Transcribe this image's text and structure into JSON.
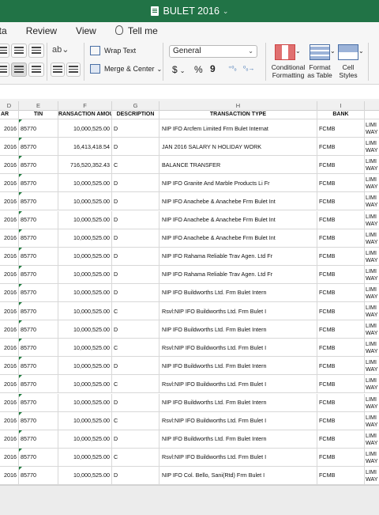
{
  "app": {
    "title": "BULET 2016",
    "accent": "#217346"
  },
  "menu": {
    "items": [
      "ata",
      "Review",
      "View"
    ],
    "tell_me": "Tell me"
  },
  "ribbon": {
    "wrap_text": "Wrap Text",
    "merge_center": "Merge & Center",
    "number_format": "General",
    "currency_symbol": "$",
    "percent_symbol": "%",
    "comma_symbol": "9",
    "increase_decimal": ".00→.0",
    "decrease_decimal": ".0→.00",
    "conditional_formatting": [
      "Conditional",
      "Formatting"
    ],
    "format_as_table": [
      "Format",
      "as Table"
    ],
    "cell_styles": [
      "Cell",
      "Styles"
    ]
  },
  "columns": [
    "D",
    "E",
    "F",
    "G",
    "H",
    "I"
  ],
  "headers": [
    "AR",
    "TIN",
    "RANSACTION AMOUN",
    "DESCRIPTION",
    "TRANSACTION TYPE",
    "BANK"
  ],
  "rows": [
    {
      "year": "2016",
      "tin": "85770",
      "amount": "10,000,525.00",
      "desc": "D",
      "type": "NIP IFO Arcfem Limited Frm Bulet Internat",
      "bank": "FCMB",
      "extra1": "LIMI",
      "extra2": "WAY"
    },
    {
      "year": "2016",
      "tin": "85770",
      "amount": "16,413,418.54",
      "desc": "D",
      "type": "JAN 2016 SALARY N HOLIDAY WORK",
      "bank": "FCMB",
      "extra1": "LIMI",
      "extra2": "WAY"
    },
    {
      "year": "2016",
      "tin": "85770",
      "amount": "716,520,352.43",
      "desc": "C",
      "type": "BALANCE TRANSFER",
      "bank": "FCMB",
      "extra1": "LIMI",
      "extra2": "WAY"
    },
    {
      "year": "2016",
      "tin": "85770",
      "amount": "10,000,525.00",
      "desc": "D",
      "type": "NIP IFO Granite And Marble Products Li Fr",
      "bank": "FCMB",
      "extra1": "LIMI",
      "extra2": "WAY"
    },
    {
      "year": "2016",
      "tin": "85770",
      "amount": "10,000,525.00",
      "desc": "D",
      "type": "NIP IFO Anachebe & Anachebe Frm Bulet Int",
      "bank": "FCMB",
      "extra1": "LIMI",
      "extra2": "WAY"
    },
    {
      "year": "2016",
      "tin": "85770",
      "amount": "10,000,525.00",
      "desc": "D",
      "type": "NIP IFO Anachebe & Anachebe Frm Bulet Int",
      "bank": "FCMB",
      "extra1": "LIMI",
      "extra2": "WAY"
    },
    {
      "year": "2016",
      "tin": "85770",
      "amount": "10,000,525.00",
      "desc": "D",
      "type": "NIP IFO Anachebe & Anachebe Frm Bulet Int",
      "bank": "FCMB",
      "extra1": "LIMI",
      "extra2": "WAY"
    },
    {
      "year": "2016",
      "tin": "85770",
      "amount": "10,000,525.00",
      "desc": "D",
      "type": "NIP IFO Rahama Reliable Trav Agen. Ltd Fr",
      "bank": "FCMB",
      "extra1": "LIMI",
      "extra2": "WAY"
    },
    {
      "year": "2016",
      "tin": "85770",
      "amount": "10,000,525.00",
      "desc": "D",
      "type": "NIP IFO Rahama Reliable Trav Agen. Ltd Fr",
      "bank": "FCMB",
      "extra1": "LIMI",
      "extra2": "WAY"
    },
    {
      "year": "2016",
      "tin": "85770",
      "amount": "10,000,525.00",
      "desc": "D",
      "type": "NIP IFO Buildworths Ltd. Frm Bulet Intern",
      "bank": "FCMB",
      "extra1": "LIMI",
      "extra2": "WAY"
    },
    {
      "year": "2016",
      "tin": "85770",
      "amount": "10,000,525.00",
      "desc": "C",
      "type": "Rsvl:NIP IFO Buildworths Ltd. Frm Bulet I",
      "bank": "FCMB",
      "extra1": "LIMI",
      "extra2": "WAY"
    },
    {
      "year": "2016",
      "tin": "85770",
      "amount": "10,000,525.00",
      "desc": "D",
      "type": "NIP IFO Buildworths Ltd. Frm Bulet Intern",
      "bank": "FCMB",
      "extra1": "LIMI",
      "extra2": "WAY"
    },
    {
      "year": "2016",
      "tin": "85770",
      "amount": "10,000,525.00",
      "desc": "C",
      "type": "Rsvl:NIP IFO Buildworths Ltd. Frm Bulet I",
      "bank": "FCMB",
      "extra1": "LIMI",
      "extra2": "WAY"
    },
    {
      "year": "2016",
      "tin": "85770",
      "amount": "10,000,525.00",
      "desc": "D",
      "type": "NIP IFO Buildworths Ltd. Frm Bulet Intern",
      "bank": "FCMB",
      "extra1": "LIMI",
      "extra2": "WAY"
    },
    {
      "year": "2016",
      "tin": "85770",
      "amount": "10,000,525.00",
      "desc": "C",
      "type": "Rsvl:NIP IFO Buildworths Ltd. Frm Bulet I",
      "bank": "FCMB",
      "extra1": "LIMI",
      "extra2": "WAY"
    },
    {
      "year": "2016",
      "tin": "85770",
      "amount": "10,000,525.00",
      "desc": "D",
      "type": "NIP IFO Buildworths Ltd. Frm Bulet Intern",
      "bank": "FCMB",
      "extra1": "LIMI",
      "extra2": "WAY"
    },
    {
      "year": "2016",
      "tin": "85770",
      "amount": "10,000,525.00",
      "desc": "C",
      "type": "Rsvl:NIP IFO Buildworths Ltd. Frm Bulet I",
      "bank": "FCMB",
      "extra1": "LIMI",
      "extra2": "WAY"
    },
    {
      "year": "2016",
      "tin": "85770",
      "amount": "10,000,525.00",
      "desc": "D",
      "type": "NIP IFO Buildworths Ltd. Frm Bulet Intern",
      "bank": "FCMB",
      "extra1": "LIMI",
      "extra2": "WAY"
    },
    {
      "year": "2016",
      "tin": "85770",
      "amount": "10,000,525.00",
      "desc": "C",
      "type": "Rsvl:NIP IFO Buildworths Ltd. Frm Bulet I",
      "bank": "FCMB",
      "extra1": "LIMI",
      "extra2": "WAY"
    },
    {
      "year": "2016",
      "tin": "85770",
      "amount": "10,000,525.00",
      "desc": "D",
      "type": "NIP IFO Col. Bello, Sani(Rtd) Frm Bulet I",
      "bank": "FCMB",
      "extra1": "LIMI",
      "extra2": "WAY"
    }
  ]
}
